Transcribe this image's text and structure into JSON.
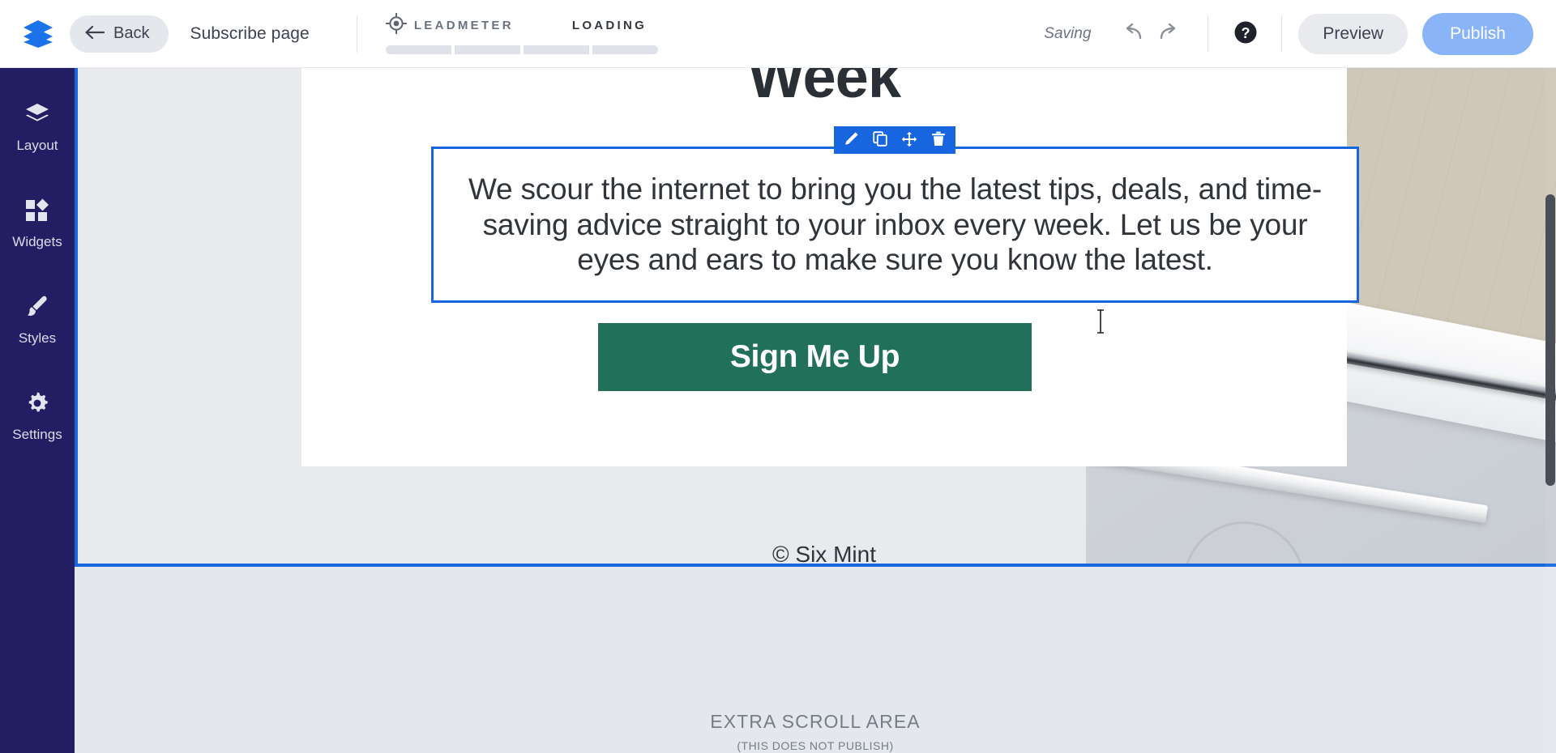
{
  "header": {
    "logo_icon": "layers-logo-icon",
    "back_label": "Back",
    "back_icon": "arrow-left-icon",
    "page_title": "Subscribe page",
    "leadmeter": {
      "icon": "target-crosshair-icon",
      "label": "LEADMETER",
      "status": "LOADING",
      "segments": 4,
      "filled": 0,
      "bar_color": "#dfe2e8"
    },
    "saving_status": "Saving",
    "undo_icon": "undo-arrow-icon",
    "redo_icon": "redo-arrow-icon",
    "help_icon": "help-question-icon",
    "preview_label": "Preview",
    "publish_label": "Publish",
    "publish_color": "#8ab4f8"
  },
  "sidebar": {
    "background": "#231e63",
    "items": [
      {
        "icon": "layers-icon",
        "label": "Layout"
      },
      {
        "icon": "widgets-icon",
        "label": "Widgets"
      },
      {
        "icon": "brush-icon",
        "label": "Styles"
      },
      {
        "icon": "gear-icon",
        "label": "Settings"
      }
    ]
  },
  "canvas": {
    "selection_color": "#1766e0",
    "hero": {
      "heading": "Week",
      "selected_text": "We scour the internet to bring you the latest tips, deals, and time-saving advice straight to your inbox every week. Let us be your eyes and ears to make sure you know the latest.",
      "cta_label": "Sign Me Up",
      "cta_color": "#21715a",
      "copyright": "© Six Mint"
    },
    "element_toolbar": {
      "buttons": [
        {
          "icon": "pencil-edit-icon",
          "name": "edit"
        },
        {
          "icon": "duplicate-icon",
          "name": "duplicate"
        },
        {
          "icon": "move-arrows-icon",
          "name": "move"
        },
        {
          "icon": "trash-delete-icon",
          "name": "delete"
        }
      ]
    },
    "extra_scroll": {
      "title": "EXTRA SCROLL AREA",
      "subtitle": "(THIS DOES NOT PUBLISH)"
    }
  },
  "cursor": {
    "type": "text-ibeam"
  }
}
